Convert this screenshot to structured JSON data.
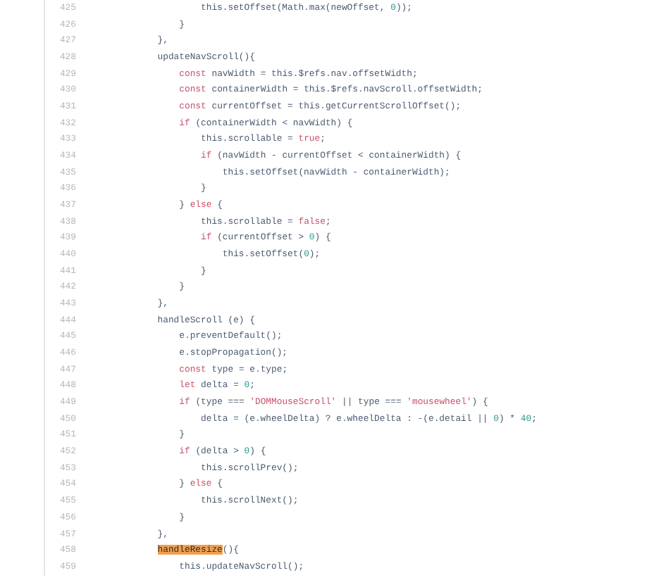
{
  "code_view": {
    "lines": [
      {
        "number": "425",
        "code": [
          "                this.setOffset(Math.max(newOffset, ",
          {
            "kind": "num",
            "t": "0"
          },
          "));"
        ]
      },
      {
        "number": "426",
        "code": [
          "            }"
        ]
      },
      {
        "number": "427",
        "code": [
          "        },"
        ]
      },
      {
        "number": "428",
        "code": [
          "        updateNavScroll(){"
        ]
      },
      {
        "number": "429",
        "code": [
          {
            "kind": "kw",
            "t": "            const"
          },
          " navWidth = this.$refs.nav.offsetWidth;"
        ]
      },
      {
        "number": "430",
        "code": [
          {
            "kind": "kw",
            "t": "            const"
          },
          " containerWidth = this.$refs.navScroll.offsetWidth;"
        ]
      },
      {
        "number": "431",
        "code": [
          {
            "kind": "kw",
            "t": "            const"
          },
          " currentOffset = this.getCurrentScrollOffset();"
        ]
      },
      {
        "number": "432",
        "code": [
          {
            "kind": "kw",
            "t": "            if"
          },
          " (containerWidth < navWidth) {"
        ]
      },
      {
        "number": "433",
        "code": [
          "                this.scrollable = ",
          {
            "kind": "kw",
            "t": "true"
          },
          ";"
        ]
      },
      {
        "number": "434",
        "code": [
          {
            "kind": "kw",
            "t": "                if"
          },
          " (navWidth - currentOffset < containerWidth) {"
        ]
      },
      {
        "number": "435",
        "code": [
          "                    this.setOffset(navWidth - containerWidth);"
        ]
      },
      {
        "number": "436",
        "code": [
          "                }"
        ]
      },
      {
        "number": "437",
        "code": [
          "            } ",
          {
            "kind": "kw",
            "t": "else"
          },
          " {"
        ]
      },
      {
        "number": "438",
        "code": [
          "                this.scrollable = ",
          {
            "kind": "kw",
            "t": "false"
          },
          ";"
        ]
      },
      {
        "number": "439",
        "code": [
          {
            "kind": "kw",
            "t": "                if"
          },
          " (currentOffset > ",
          {
            "kind": "num",
            "t": "0"
          },
          ") {"
        ]
      },
      {
        "number": "440",
        "code": [
          "                    this.setOffset(",
          {
            "kind": "num",
            "t": "0"
          },
          ");"
        ]
      },
      {
        "number": "441",
        "code": [
          "                }"
        ]
      },
      {
        "number": "442",
        "code": [
          "            }"
        ]
      },
      {
        "number": "443",
        "code": [
          "        },"
        ]
      },
      {
        "number": "444",
        "code": [
          "        handleScroll (e) {"
        ]
      },
      {
        "number": "445",
        "code": [
          "            e.preventDefault();"
        ]
      },
      {
        "number": "446",
        "code": [
          "            e.stopPropagation();"
        ]
      },
      {
        "number": "447",
        "code": [
          {
            "kind": "kw",
            "t": "            const"
          },
          " type = e.type;"
        ]
      },
      {
        "number": "448",
        "code": [
          {
            "kind": "kw",
            "t": "            let"
          },
          " delta = ",
          {
            "kind": "num",
            "t": "0"
          },
          ";"
        ]
      },
      {
        "number": "449",
        "code": [
          {
            "kind": "kw",
            "t": "            if"
          },
          " (type === ",
          {
            "kind": "str",
            "t": "'DOMMouseScroll'"
          },
          " || type === ",
          {
            "kind": "str",
            "t": "'mousewheel'"
          },
          ") {"
        ]
      },
      {
        "number": "450",
        "code": [
          "                delta = (e.wheelDelta) ? e.wheelDelta : -(e.detail || ",
          {
            "kind": "num",
            "t": "0"
          },
          ") * ",
          {
            "kind": "num",
            "t": "40"
          },
          ";"
        ]
      },
      {
        "number": "451",
        "code": [
          "            }"
        ]
      },
      {
        "number": "452",
        "code": [
          {
            "kind": "kw",
            "t": "            if"
          },
          " (delta > ",
          {
            "kind": "num",
            "t": "0"
          },
          ") {"
        ]
      },
      {
        "number": "453",
        "code": [
          "                this.scrollPrev();"
        ]
      },
      {
        "number": "454",
        "code": [
          "            } ",
          {
            "kind": "kw",
            "t": "else"
          },
          " {"
        ]
      },
      {
        "number": "455",
        "code": [
          "                this.scrollNext();"
        ]
      },
      {
        "number": "456",
        "code": [
          "            }"
        ]
      },
      {
        "number": "457",
        "code": [
          "        },"
        ]
      },
      {
        "number": "458",
        "code": [
          {
            "kind": "mark",
            "t": "        handleResize"
          },
          "(){"
        ]
      },
      {
        "number": "459",
        "code": [
          "            this.updateNavScroll();"
        ]
      }
    ]
  }
}
